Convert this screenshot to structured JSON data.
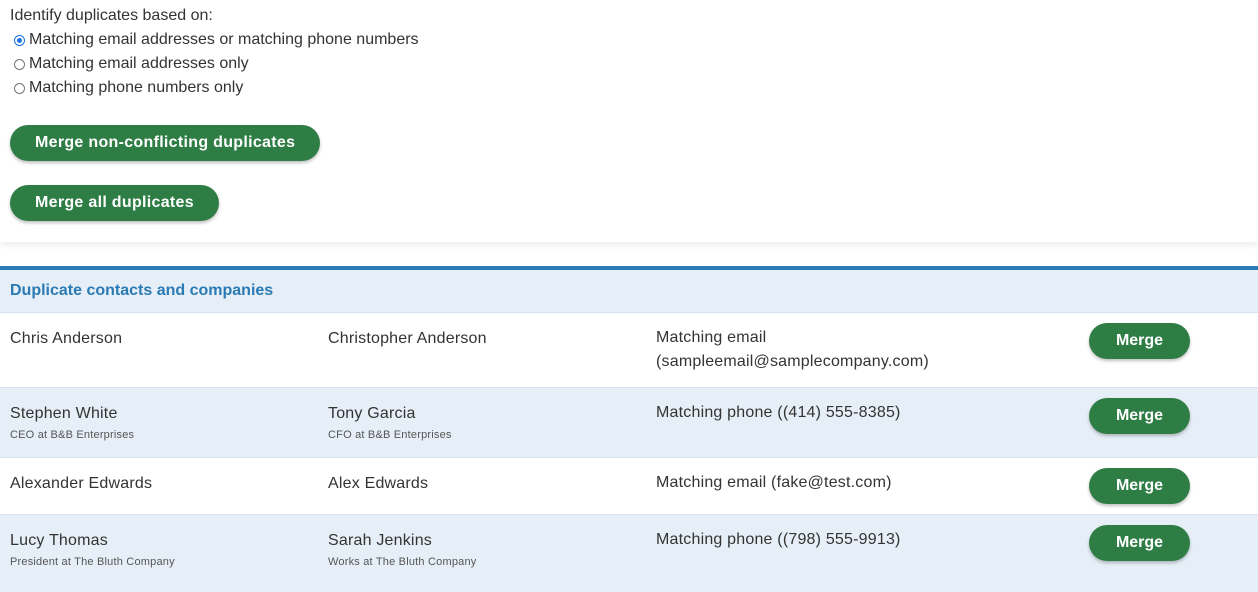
{
  "options": {
    "label": "Identify duplicates based on:",
    "radios": [
      {
        "label": "Matching email addresses or matching phone numbers",
        "checked": true
      },
      {
        "label": "Matching email addresses only",
        "checked": false
      },
      {
        "label": "Matching phone numbers only",
        "checked": false
      }
    ]
  },
  "buttons": {
    "merge_non_conflicting": "Merge non-conflicting duplicates",
    "merge_all": "Merge all duplicates"
  },
  "duplicates": {
    "title": "Duplicate contacts and companies",
    "merge_label": "Merge",
    "rows": [
      {
        "name1": "Chris Anderson",
        "sub1": "",
        "name2": "Christopher Anderson",
        "sub2": "",
        "match_line1": "Matching email",
        "match_line2": "(sampleemail@samplecompany.com)"
      },
      {
        "name1": "Stephen White",
        "sub1": "CEO at B&B Enterprises",
        "name2": "Tony Garcia",
        "sub2": "CFO at B&B Enterprises",
        "match_line1": "Matching phone ((414) 555-8385)",
        "match_line2": ""
      },
      {
        "name1": "Alexander Edwards",
        "sub1": "",
        "name2": "Alex Edwards",
        "sub2": "",
        "match_line1": "Matching email (fake@test.com)",
        "match_line2": ""
      },
      {
        "name1": "Lucy Thomas",
        "sub1": "President at The Bluth Company",
        "name2": "Sarah Jenkins",
        "sub2": "Works at The Bluth Company",
        "match_line1": "Matching phone ((798) 555-9913)",
        "match_line2": ""
      }
    ]
  },
  "colors": {
    "button_green": "#2e7d45",
    "accent_blue": "#2a7ab3",
    "row_alt": "#e6eff7"
  }
}
